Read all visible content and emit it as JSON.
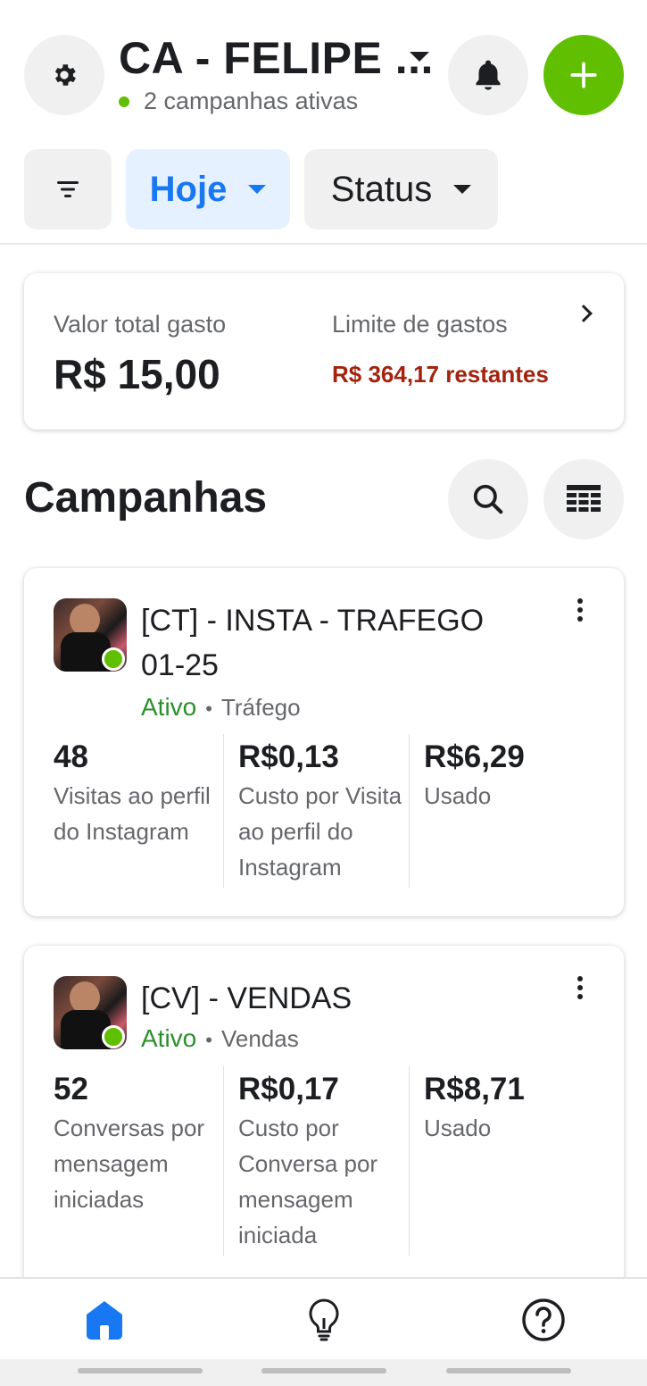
{
  "header": {
    "account_title": "CA - FELIPE ...",
    "active_campaigns": "2 campanhas ativas"
  },
  "filters": {
    "date_label": "Hoje",
    "status_label": "Status"
  },
  "summary": {
    "spent_label": "Valor total gasto",
    "spent_value": "R$ 15,00",
    "limit_label": "Limite de gastos",
    "limit_remaining": "R$ 364,17 restantes"
  },
  "campaigns_section": {
    "title": "Campanhas"
  },
  "campaigns": [
    {
      "name": "[CT] - INSTA - TRAFEGO 01-25",
      "status": "Ativo",
      "separator": "•",
      "objective": "Tráfego",
      "metrics": [
        {
          "value": "48",
          "label": "Visitas ao perfil do Instagram"
        },
        {
          "value": "R$0,13",
          "label": "Custo por Visita ao perfil do Instagram"
        },
        {
          "value": "R$6,29",
          "label": "Usado"
        }
      ]
    },
    {
      "name": "[CV] - VENDAS",
      "status": "Ativo",
      "separator": "•",
      "objective": "Vendas",
      "metrics": [
        {
          "value": "52",
          "label": "Conversas por mensagem iniciadas"
        },
        {
          "value": "R$0,17",
          "label": "Custo por Conversa por mensagem iniciada"
        },
        {
          "value": "R$8,71",
          "label": "Usado"
        }
      ]
    }
  ],
  "icons": {
    "settings": "gear-icon",
    "notifications": "bell-icon",
    "add": "plus-icon",
    "filter": "filter-icon",
    "search": "search-icon",
    "table": "table-icon",
    "home": "home-icon",
    "tips": "lightbulb-icon",
    "help": "help-icon"
  },
  "colors": {
    "brand_blue": "#1877f2",
    "active_green": "#5fbf00",
    "status_text_green": "#2a8f2a",
    "remaining_red": "#a3230e"
  }
}
